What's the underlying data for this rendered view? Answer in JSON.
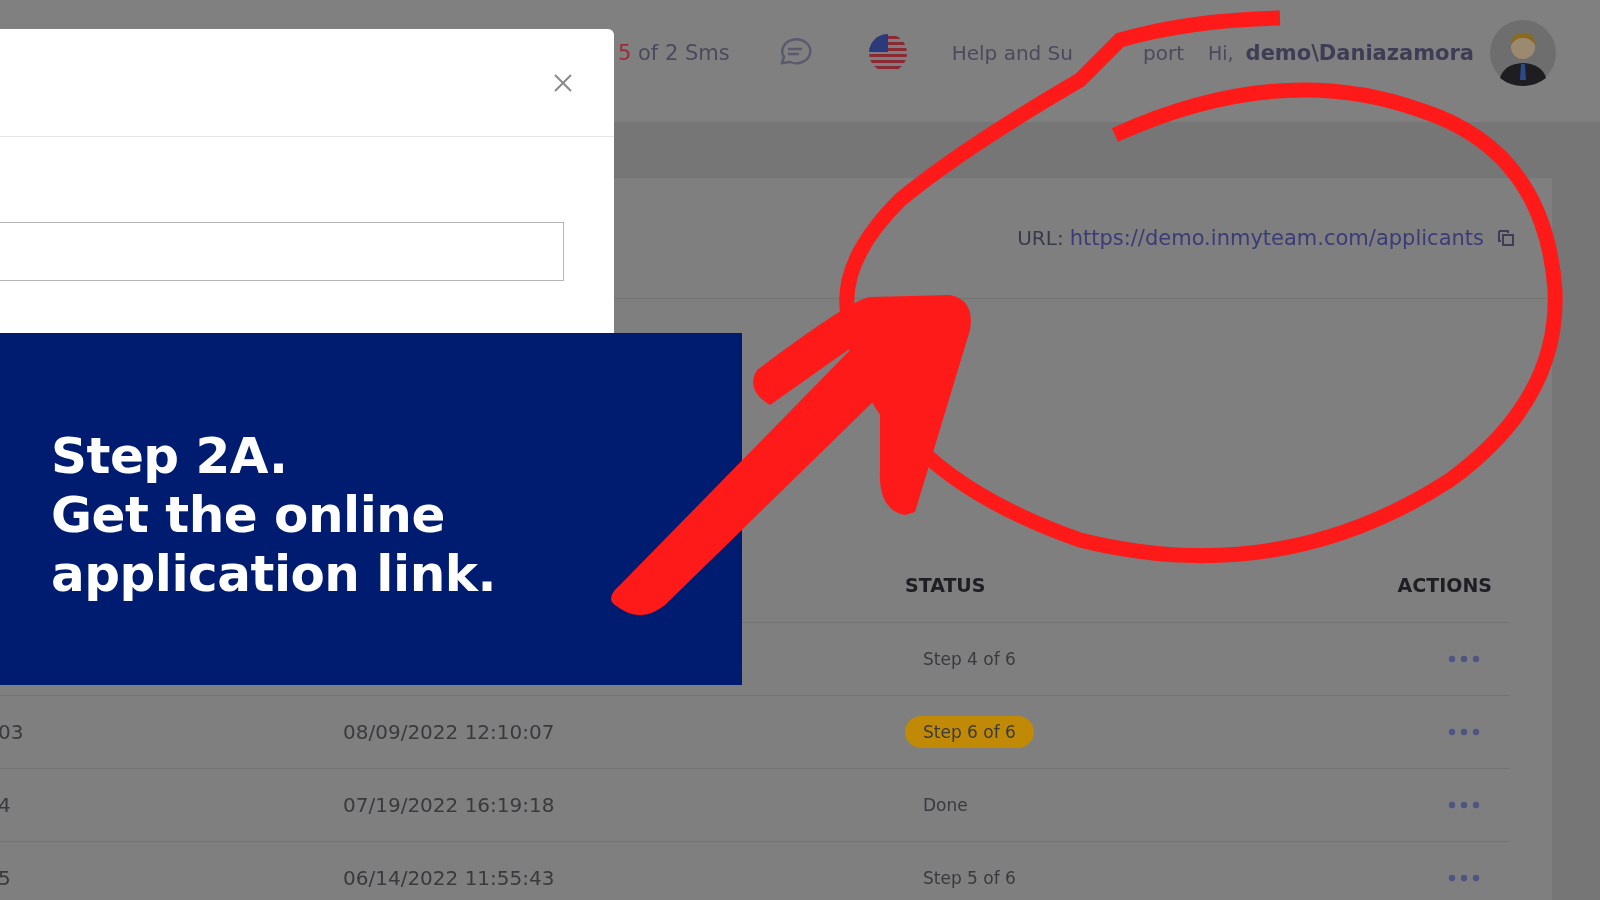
{
  "header": {
    "sms_used": "5",
    "sms_rest": "of 2 Sms",
    "help": [
      "Help and Su",
      "port"
    ],
    "greeting": "Hi,",
    "user": "demo\\Daniazamora"
  },
  "url": {
    "label": "URL:",
    "link": "https://demo.inmyteam.com/applicants"
  },
  "table": {
    "status_header": "STATUS",
    "actions_header": "ACTIONS",
    "rows": [
      {
        "status": "Step 4 of 6",
        "highlighted": false
      },
      {
        "column_1": "03",
        "date": "08/09/2022 12:10:07",
        "status": "Step 6 of 6",
        "highlighted": true
      },
      {
        "column_1": "4",
        "date": "07/19/2022 16:19:18",
        "status": "Done",
        "highlighted": false
      },
      {
        "column_1": "5",
        "date": "06/14/2022 11:55:43",
        "status": "Step 5 of 6",
        "highlighted": false
      }
    ]
  },
  "banner": {
    "lines": [
      "Step 2A.",
      "Get the online",
      "application link."
    ]
  }
}
